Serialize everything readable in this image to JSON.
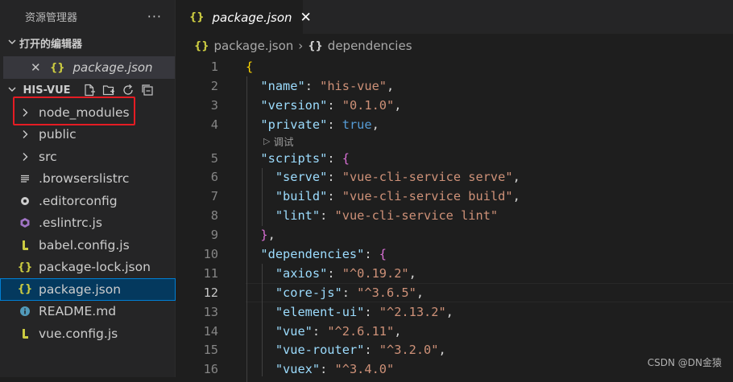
{
  "sidebar": {
    "title": "资源管理器",
    "more": "···",
    "open_editors_title": "打开的编辑器",
    "open_editor_file": "package.json",
    "project_title": "HIS-VUE",
    "tree": [
      {
        "label": "node_modules",
        "kind": "folder"
      },
      {
        "label": "public",
        "kind": "folder"
      },
      {
        "label": "src",
        "kind": "folder"
      },
      {
        "label": ".browserslistrc",
        "kind": "file"
      },
      {
        "label": ".editorconfig",
        "kind": "config"
      },
      {
        "label": ".eslintrc.js",
        "kind": "eslint"
      },
      {
        "label": "babel.config.js",
        "kind": "js"
      },
      {
        "label": "package-lock.json",
        "kind": "json"
      },
      {
        "label": "package.json",
        "kind": "json",
        "selected": true
      },
      {
        "label": "README.md",
        "kind": "info"
      },
      {
        "label": "vue.config.js",
        "kind": "js"
      }
    ]
  },
  "editor": {
    "tab": {
      "label": "package.json",
      "close": "✕"
    },
    "breadcrumbs": {
      "file": "package.json",
      "symbol": "dependencies"
    },
    "codelens": "调试",
    "current_line": 12,
    "lines": [
      {
        "n": "1",
        "indent": 0,
        "key": "",
        "val": "",
        "type": "open1"
      },
      {
        "n": "2",
        "indent": 1,
        "key": "\"name\"",
        "val": "\"his-vue\"",
        "type": "str"
      },
      {
        "n": "3",
        "indent": 1,
        "key": "\"version\"",
        "val": "\"0.1.0\"",
        "type": "str"
      },
      {
        "n": "4",
        "indent": 1,
        "key": "\"private\"",
        "val": "true",
        "type": "bool"
      },
      {
        "n": "5",
        "indent": 1,
        "key": "\"scripts\"",
        "val": "",
        "type": "open2"
      },
      {
        "n": "6",
        "indent": 2,
        "key": "\"serve\"",
        "val": "\"vue-cli-service serve\"",
        "type": "str"
      },
      {
        "n": "7",
        "indent": 2,
        "key": "\"build\"",
        "val": "\"vue-cli-service build\"",
        "type": "str"
      },
      {
        "n": "8",
        "indent": 2,
        "key": "\"lint\"",
        "val": "\"vue-cli-service lint\"",
        "type": "strlast"
      },
      {
        "n": "9",
        "indent": 1,
        "key": "",
        "val": "",
        "type": "close2"
      },
      {
        "n": "10",
        "indent": 1,
        "key": "\"dependencies\"",
        "val": "",
        "type": "open2"
      },
      {
        "n": "11",
        "indent": 2,
        "key": "\"axios\"",
        "val": "\"^0.19.2\"",
        "type": "str"
      },
      {
        "n": "12",
        "indent": 2,
        "key": "\"core-js\"",
        "val": "\"^3.6.5\"",
        "type": "str"
      },
      {
        "n": "13",
        "indent": 2,
        "key": "\"element-ui\"",
        "val": "\"^2.13.2\"",
        "type": "str"
      },
      {
        "n": "14",
        "indent": 2,
        "key": "\"vue\"",
        "val": "\"^2.6.11\"",
        "type": "str"
      },
      {
        "n": "15",
        "indent": 2,
        "key": "\"vue-router\"",
        "val": "\"^3.2.0\"",
        "type": "str"
      },
      {
        "n": "16",
        "indent": 2,
        "key": "\"vuex\"",
        "val": "\"^3.4.0\"",
        "type": "strlast"
      }
    ]
  },
  "watermark": "CSDN @DN金猿",
  "colors": {
    "accent": "#007fd4",
    "highlight_box": "#e51c23",
    "json_icon": "#cbcb41"
  }
}
